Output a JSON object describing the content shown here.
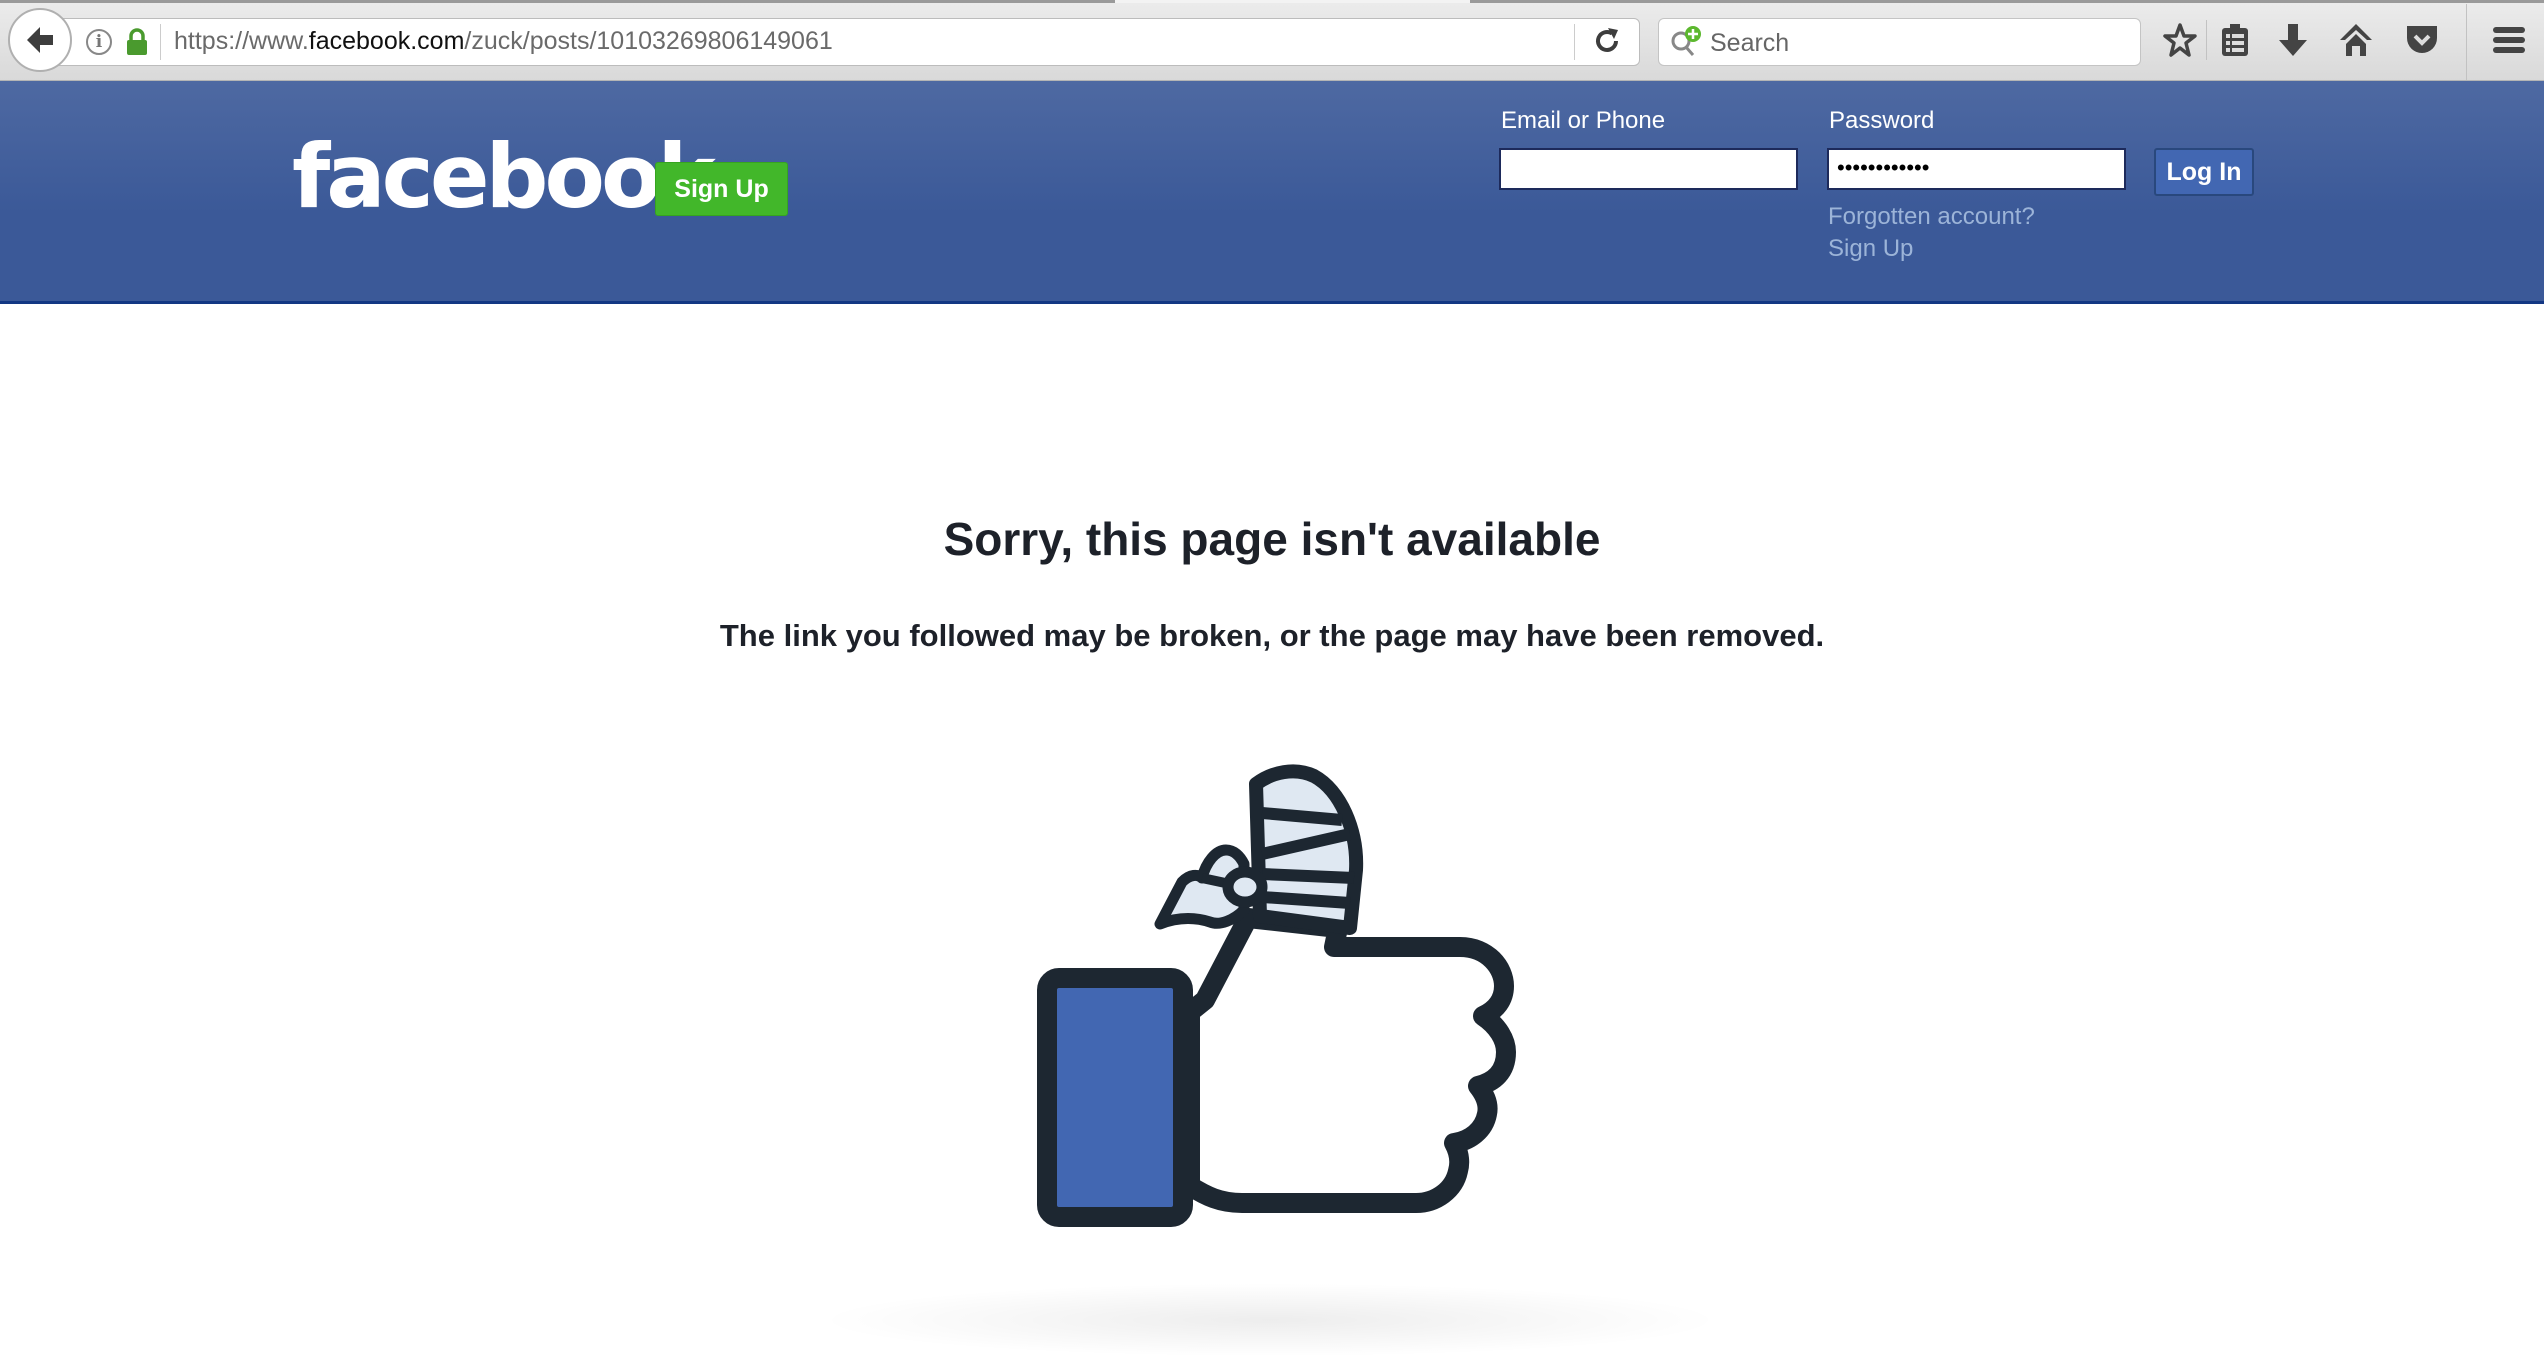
{
  "browser": {
    "url_prefix": "https://www.",
    "url_domain": "facebook.com",
    "url_path": "/zuck/posts/10103269806149061",
    "search_placeholder": "Search",
    "icons": [
      "back-icon",
      "info-icon",
      "lock-icon",
      "reload-icon",
      "search-add-icon",
      "bookmark-star-icon",
      "reading-list-icon",
      "download-icon",
      "home-icon",
      "pocket-icon",
      "menu-icon"
    ]
  },
  "header": {
    "logo": "facebook",
    "signup_button": "Sign Up",
    "email_label": "Email or Phone",
    "email_value": "",
    "password_label": "Password",
    "password_value": "••••••••••••",
    "login_button": "Log In",
    "forgotten_link": "Forgotten account?",
    "signup_link": "Sign Up",
    "colors": {
      "brand": "#3b5998",
      "signup_green": "#42b72a",
      "link": "#9cb4d8"
    }
  },
  "main": {
    "title": "Sorry, this page isn't available",
    "message": "The link you followed may be broken, or the page may have been removed.",
    "illustration": "broken-thumbs-up-icon",
    "colors": {
      "cuff": "#4267b2",
      "outline": "#1d2731",
      "bandage": "#dfe8f2"
    }
  }
}
